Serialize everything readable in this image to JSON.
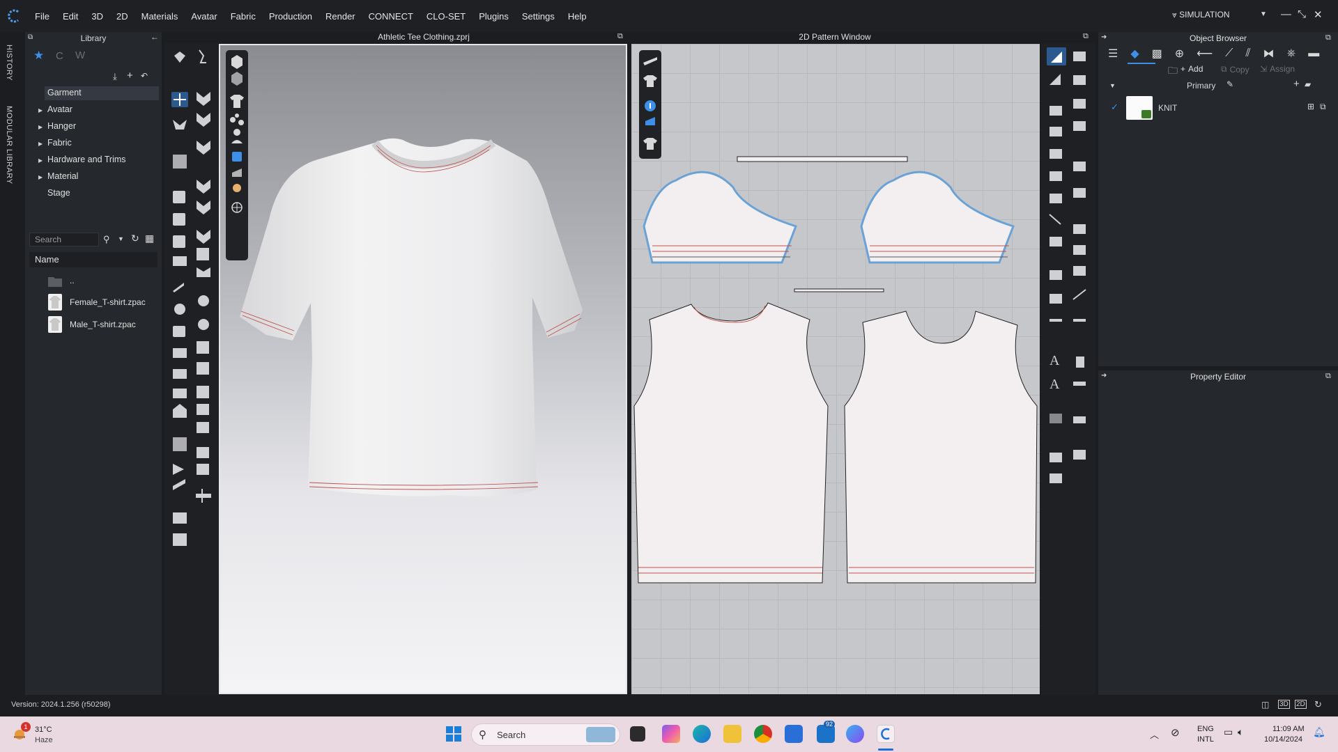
{
  "menubar": {
    "items": [
      "File",
      "Edit",
      "3D",
      "2D",
      "Materials",
      "Avatar",
      "Fabric",
      "Production",
      "Render",
      "CONNECT",
      "CLO-SET",
      "Plugins",
      "Settings",
      "Help"
    ],
    "mode": "SIMULATION"
  },
  "side_tabs": {
    "history": "HISTORY",
    "modular": "MODULAR LIBRARY"
  },
  "library": {
    "title": "Library",
    "tree": [
      {
        "label": "Garment",
        "expandable": false
      },
      {
        "label": "Avatar",
        "expandable": true
      },
      {
        "label": "Hanger",
        "expandable": true
      },
      {
        "label": "Fabric",
        "expandable": true
      },
      {
        "label": "Hardware and Trims",
        "expandable": true
      },
      {
        "label": "Material",
        "expandable": true
      },
      {
        "label": "Stage",
        "expandable": false
      }
    ],
    "search_placeholder": "Search",
    "name_header": "Name",
    "files": [
      {
        "label": "..",
        "icon": "folder-icon"
      },
      {
        "label": "Female_T-shirt.zpac",
        "icon": "tshirt-file-icon"
      },
      {
        "label": "Male_T-shirt.zpac",
        "icon": "tshirt-file-icon"
      }
    ]
  },
  "viewport3d": {
    "title": "Athletic Tee Clothing.zprj"
  },
  "viewport2d": {
    "title": "2D Pattern Window"
  },
  "object_browser": {
    "title": "Object Browser",
    "add_label": "Add",
    "copy_label": "Copy",
    "assign_label": "Assign",
    "group_label": "Primary",
    "fabric_name": "KNIT"
  },
  "property_editor": {
    "title": "Property Editor"
  },
  "status": {
    "version": "Version: 2024.1.256 (r50298)"
  },
  "taskbar": {
    "weather_temp": "31°C",
    "weather_desc": "Haze",
    "weather_badge": "1",
    "search_placeholder": "Search",
    "mail_badge": "92",
    "lang_1": "ENG",
    "lang_2": "INTL",
    "time": "11:09 AM",
    "date": "10/14/2024"
  },
  "colors": {
    "accent": "#3d8fe8",
    "panel": "#25282d",
    "taskbar": "#ead9e1",
    "pattern_fill": "#f3eff0",
    "seam_red": "#c0504d"
  }
}
